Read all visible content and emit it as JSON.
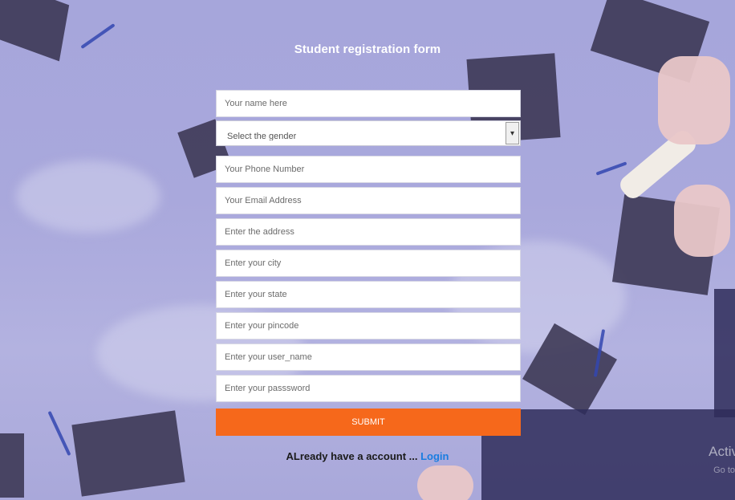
{
  "form": {
    "title": "Student registration form",
    "name_placeholder": "Your name here",
    "gender_selected": "Select the gender",
    "phone_placeholder": "Your Phone Number",
    "email_placeholder": "Your Email Address",
    "address_placeholder": "Enter the address",
    "city_placeholder": "Enter your city",
    "state_placeholder": "Enter your state",
    "pincode_placeholder": "Enter your pincode",
    "username_placeholder": "Enter your user_name",
    "password_placeholder": "Enter your passsword",
    "submit_label": "SUBMIT"
  },
  "footer": {
    "text": "ALready have a account ... ",
    "login_label": "Login"
  },
  "watermark": {
    "text": "Activ",
    "sub": "Go to"
  },
  "colors": {
    "accent": "#f6681b",
    "link": "#1a7de0",
    "background": "#a9a8dc"
  },
  "icons": {
    "select_arrow": "chevron-down-icon"
  }
}
